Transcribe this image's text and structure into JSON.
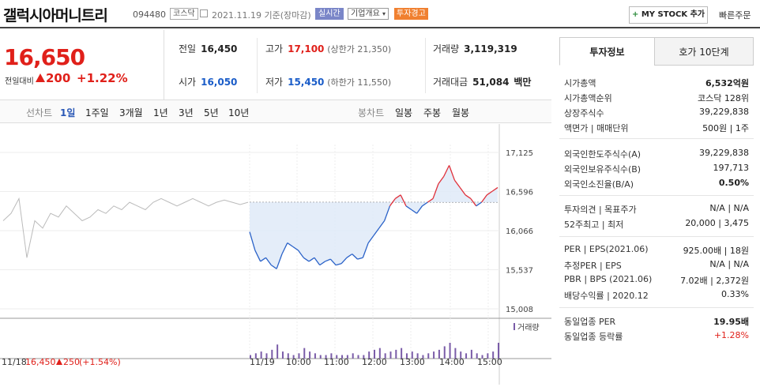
{
  "header": {
    "title": "갤럭시아머니트리",
    "code": "094480",
    "market": "코스닥",
    "date": "2021.11.19 기준(장마감)",
    "badge_realtime": "실시간",
    "badge_summary": "기업개요",
    "badge_warning": "투자경고",
    "mystock": "MY STOCK 추가",
    "quick_order": "빠른주문"
  },
  "price": {
    "now": "16,650",
    "change_label": "전일대비",
    "change_value": "200",
    "change_percent": "+1.22%"
  },
  "stats": {
    "prev_label": "전일",
    "prev": "16,450",
    "high_label": "고가",
    "high": "17,100",
    "upper_limit": "(상한가 21,350)",
    "volume_label": "거래량",
    "volume": "3,119,319",
    "open_label": "시가",
    "open": "16,050",
    "low_label": "저가",
    "low": "15,450",
    "lower_limit": "(하한가 11,550)",
    "amount_label": "거래대금",
    "amount": "51,084",
    "amount_unit": "백만"
  },
  "periods": {
    "line_label": "선차트",
    "items": [
      "1일",
      "1주일",
      "3개월",
      "1년",
      "3년",
      "5년",
      "10년"
    ],
    "candle_label": "봉차트",
    "candle_items": [
      "일봉",
      "주봉",
      "월봉"
    ]
  },
  "chart_data": {
    "type": "line",
    "y_ticks": [
      "17,125",
      "16,596",
      "16,066",
      "15,537",
      "15,008"
    ],
    "ylim": [
      15008,
      17125
    ],
    "prev_close": 16450,
    "x_ticks": [
      "11/19",
      "10:00",
      "11:00",
      "12:00",
      "13:00",
      "14:00",
      "15:00"
    ],
    "prev_day_label": "11/18",
    "prev_day_price": "16,450",
    "prev_day_change": "250",
    "prev_day_percent": "(+1.54%)",
    "volume_label": "거래량",
    "series": [
      {
        "values": [
          16050,
          15800,
          15650,
          15700,
          15600,
          15550,
          15750,
          15900,
          15850,
          15800,
          15700,
          15650,
          15700,
          15600,
          15650,
          15680,
          15600,
          15620,
          15700,
          15750,
          15680,
          15700,
          15900,
          16000,
          16100,
          16200,
          16400,
          16500,
          16550,
          16400,
          16350,
          16300,
          16400,
          16450,
          16500,
          16700,
          16800,
          16950,
          16750,
          16650,
          16550,
          16500,
          16400,
          16450,
          16550,
          16600,
          16650
        ]
      }
    ],
    "prev_series": [
      {
        "values": [
          16200,
          16300,
          16500,
          15700,
          16200,
          16100,
          16300,
          16250,
          16400,
          16300,
          16200,
          16250,
          16350,
          16300,
          16400,
          16350,
          16450,
          16400,
          16350,
          16450,
          16500,
          16450,
          16400,
          16450,
          16500,
          16450,
          16400,
          16450,
          16480,
          16450,
          16420,
          16450
        ]
      }
    ],
    "volume": [
      2,
      3,
      4,
      3,
      5,
      8,
      4,
      3,
      2,
      3,
      6,
      4,
      3,
      2,
      2,
      3,
      2,
      2,
      2,
      3,
      2,
      2,
      4,
      5,
      6,
      3,
      4,
      5,
      6,
      3,
      4,
      3,
      2,
      3,
      4,
      5,
      7,
      9,
      6,
      4,
      3,
      5,
      3,
      2,
      3,
      4,
      9
    ]
  },
  "panel": {
    "tab_info": "투자정보",
    "tab_hoga": "호가 10단계",
    "rows1": [
      {
        "k": "시가총액",
        "v": "6,532억원",
        "b": true
      },
      {
        "k": "시가총액순위",
        "v": "코스닥 128위",
        "b": false
      },
      {
        "k": "상장주식수",
        "v": "39,229,838",
        "b": false
      },
      {
        "k": "액면가 | 매매단위",
        "v": "500원 | 1주",
        "b": false
      }
    ],
    "rows2": [
      {
        "k": "외국인한도주식수(A)",
        "v": "39,229,838",
        "b": false
      },
      {
        "k": "외국인보유주식수(B)",
        "v": "197,713",
        "b": false
      },
      {
        "k": "외국인소진율(B/A)",
        "v": "0.50%",
        "b": true
      }
    ],
    "rows3": [
      {
        "k": "투자의견 | 목표주가",
        "v": "N/A | N/A",
        "b": false
      },
      {
        "k": "52주최고 | 최저",
        "v": "20,000 | 3,475",
        "b": false
      }
    ],
    "rows4": [
      {
        "k": "PER | EPS(2021.06)",
        "v": "925.00배 | 18원",
        "b": false
      },
      {
        "k": "추정PER | EPS",
        "v": "N/A | N/A",
        "b": false
      },
      {
        "k": "PBR | BPS (2021.06)",
        "v": "7.02배 | 2,372원",
        "b": false
      },
      {
        "k": "배당수익률 | 2020.12",
        "v": "0.33%",
        "b": false
      }
    ],
    "rows5": [
      {
        "k": "동일업종 PER",
        "v": "19.95배",
        "b": true
      },
      {
        "k": "동일업종 등락률",
        "v": "+1.28%",
        "b": false,
        "red": true
      }
    ]
  }
}
